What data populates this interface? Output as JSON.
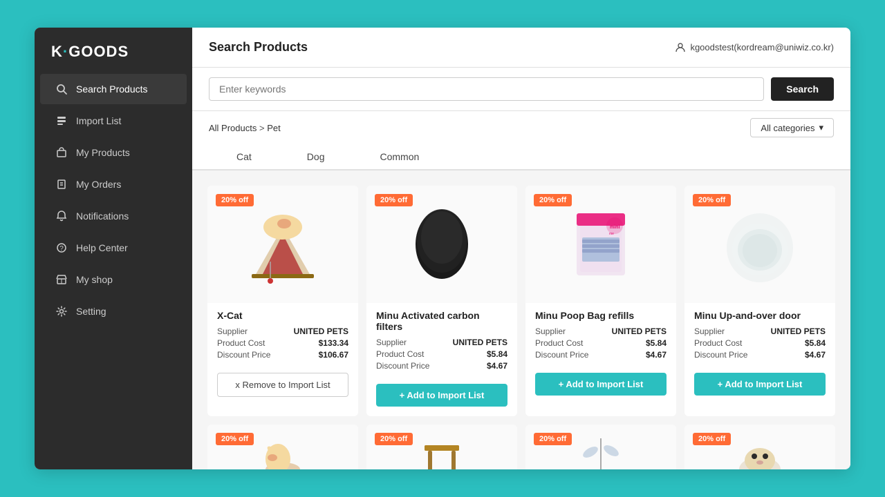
{
  "window": {
    "title": "K·GOODS"
  },
  "sidebar": {
    "logo_k": "K",
    "logo_separator": "·",
    "logo_goods": "GOODS",
    "nav_items": [
      {
        "id": "search-products",
        "label": "Search Products",
        "active": true,
        "icon": "search"
      },
      {
        "id": "import-list",
        "label": "Import List",
        "active": false,
        "icon": "list"
      },
      {
        "id": "my-products",
        "label": "My Products",
        "active": false,
        "icon": "box"
      },
      {
        "id": "my-orders",
        "label": "My Orders",
        "active": false,
        "icon": "orders"
      },
      {
        "id": "notifications",
        "label": "Notifications",
        "active": false,
        "icon": "bell"
      },
      {
        "id": "help-center",
        "label": "Help Center",
        "active": false,
        "icon": "help"
      },
      {
        "id": "my-shop",
        "label": "My shop",
        "active": false,
        "icon": "shop"
      },
      {
        "id": "setting",
        "label": "Setting",
        "active": false,
        "icon": "gear"
      }
    ]
  },
  "header": {
    "title": "Search Products",
    "user": "kgoodstest(kordream@uniwiz.co.kr)"
  },
  "search": {
    "placeholder": "Enter keywords",
    "button_label": "Search"
  },
  "breadcrumb": {
    "prefix": "All Products",
    "separator": ">",
    "current": "Pet"
  },
  "categories_dropdown": {
    "label": "All categories"
  },
  "tabs": [
    {
      "id": "cat",
      "label": "Cat",
      "active": false
    },
    {
      "id": "dog",
      "label": "Dog",
      "active": false
    },
    {
      "id": "common",
      "label": "Common",
      "active": false
    }
  ],
  "products": [
    {
      "id": "p1",
      "name": "X-Cat",
      "discount": "20% off",
      "supplier": "UNITED PETS",
      "product_cost": "$133.34",
      "discount_price": "$106.67",
      "btn_type": "remove",
      "btn_label": "x Remove to Import List",
      "bg_color": "#f9f9f9"
    },
    {
      "id": "p2",
      "name": "Minu Activated carbon filters",
      "discount": "20% off",
      "supplier": "UNITED PETS",
      "product_cost": "$5.84",
      "discount_price": "$4.67",
      "btn_type": "add",
      "btn_label": "+ Add to Import List",
      "bg_color": "#f9f9f9"
    },
    {
      "id": "p3",
      "name": "Minu Poop Bag refills",
      "discount": "20% off",
      "supplier": "UNITED PETS",
      "product_cost": "$5.84",
      "discount_price": "$4.67",
      "btn_type": "add",
      "btn_label": "+ Add to Import List",
      "bg_color": "#f9f9f9"
    },
    {
      "id": "p4",
      "name": "Minu Up-and-over door",
      "discount": "20% off",
      "supplier": "UNITED PETS",
      "product_cost": "$5.84",
      "discount_price": "$4.67",
      "btn_type": "add",
      "btn_label": "+ Add to Import List",
      "bg_color": "#f9f9f9"
    }
  ],
  "labels": {
    "supplier": "Supplier",
    "product_cost": "Product Cost",
    "discount_price": "Discount Price"
  },
  "second_row_badges": [
    "20% off",
    "20% off",
    "20% off",
    "20% off"
  ]
}
